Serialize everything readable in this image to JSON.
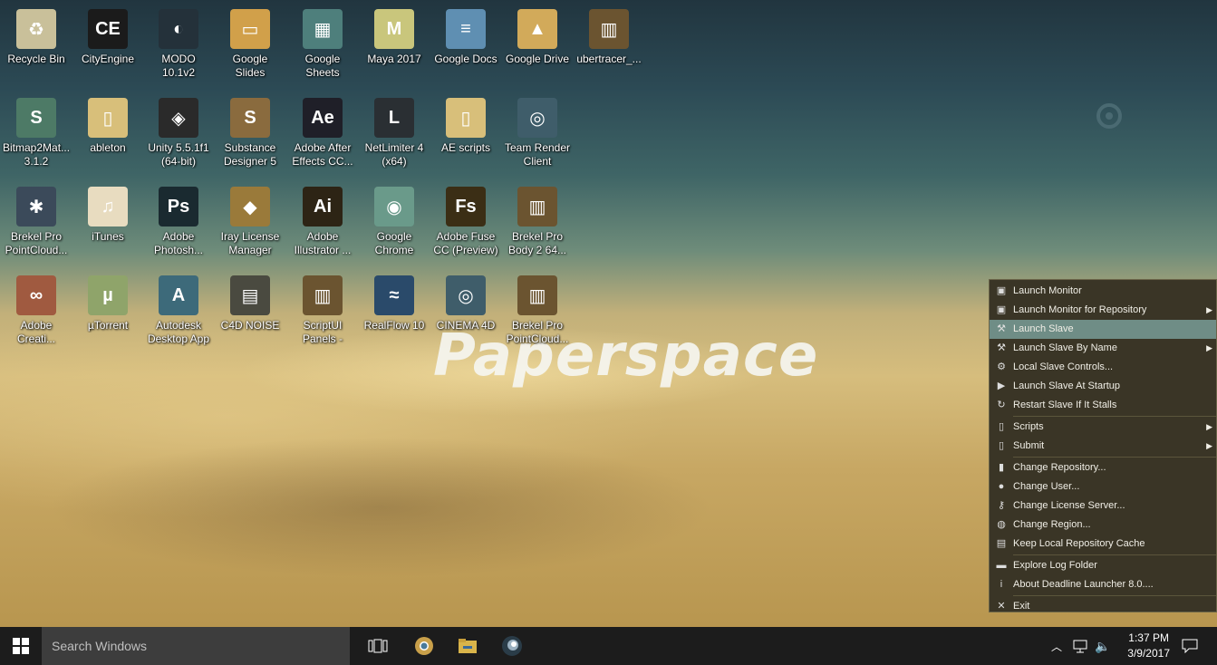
{
  "desktop": {
    "watermark": "Paperspace",
    "icons": [
      {
        "label": "Recycle Bin",
        "glyph": "♻",
        "color": "#c9c09a"
      },
      {
        "label": "CityEngine",
        "glyph": "CE",
        "color": "#1b1b1b"
      },
      {
        "label": "MODO 10.1v2",
        "glyph": "◐",
        "color": "#24313a"
      },
      {
        "label": "Google Slides",
        "glyph": "▭",
        "color": "#d1a04a"
      },
      {
        "label": "Google Sheets",
        "glyph": "▦",
        "color": "#4e7f7c"
      },
      {
        "label": "Maya 2017",
        "glyph": "M",
        "color": "#c9c67c"
      },
      {
        "label": "Google Docs",
        "glyph": "≡",
        "color": "#5f8fb2"
      },
      {
        "label": "Google Drive",
        "glyph": "▲",
        "color": "#d2aa5a"
      },
      {
        "label": "ubertracer_...",
        "glyph": "▥",
        "color": "#6b5430"
      },
      {
        "label": "Bitmap2Mat... 3.1.2",
        "glyph": "S",
        "color": "#4d7a66"
      },
      {
        "label": "ableton",
        "glyph": "▯",
        "color": "#d8bf7a"
      },
      {
        "label": "Unity 5.5.1f1 (64-bit)",
        "glyph": "◈",
        "color": "#2a2a2a"
      },
      {
        "label": "Substance Designer 5",
        "glyph": "S",
        "color": "#8a6b3e"
      },
      {
        "label": "Adobe After Effects CC...",
        "glyph": "Ae",
        "color": "#1f1f28"
      },
      {
        "label": "NetLimiter 4 (x64)",
        "glyph": "L",
        "color": "#2a2f33"
      },
      {
        "label": "AE scripts",
        "glyph": "▯",
        "color": "#d8bf7a"
      },
      {
        "label": "Team Render Client",
        "glyph": "◎",
        "color": "#3f5d6a"
      },
      {
        "label": "Brekel Pro PointCloud...",
        "glyph": "✱",
        "color": "#3b4a5a"
      },
      {
        "label": "iTunes",
        "glyph": "♫",
        "color": "#e8dcc0"
      },
      {
        "label": "Adobe Photosh...",
        "glyph": "Ps",
        "color": "#1a2a30"
      },
      {
        "label": "Iray License Manager",
        "glyph": "◆",
        "color": "#9a7a3a"
      },
      {
        "label": "Adobe Illustrator ...",
        "glyph": "Ai",
        "color": "#2d2415"
      },
      {
        "label": "Google Chrome",
        "glyph": "◉",
        "color": "#6a9a8a"
      },
      {
        "label": "Adobe Fuse CC (Preview)",
        "glyph": "Fs",
        "color": "#3b2e15"
      },
      {
        "label": "Brekel Pro Body 2 64...",
        "glyph": "▥",
        "color": "#6b5430"
      },
      {
        "label": "Adobe Creati...",
        "glyph": "∞",
        "color": "#a05a40"
      },
      {
        "label": "µTorrent",
        "glyph": "µ",
        "color": "#8fa46a"
      },
      {
        "label": "Autodesk Desktop App",
        "glyph": "A",
        "color": "#3d6a7a"
      },
      {
        "label": "C4D NOISE",
        "glyph": "▤",
        "color": "#4a4a40"
      },
      {
        "label": "ScriptUI Panels - MOE",
        "glyph": "▥",
        "color": "#6b5430"
      },
      {
        "label": "RealFlow 10",
        "glyph": "≈",
        "color": "#2a4a6a"
      },
      {
        "label": "CINEMA 4D",
        "glyph": "◎",
        "color": "#3f5d6a"
      },
      {
        "label": "Brekel Pro PointCloud...",
        "glyph": "▥",
        "color": "#6b5430"
      }
    ]
  },
  "context_menu": {
    "items": [
      {
        "label": "Launch Monitor",
        "icon": "monitor-icon",
        "glyph": "▣",
        "submenu": false,
        "highlighted": false
      },
      {
        "label": "Launch Monitor for Repository",
        "icon": "monitor-icon",
        "glyph": "▣",
        "submenu": true,
        "highlighted": false
      },
      {
        "label": "Launch Slave",
        "icon": "hammer-icon",
        "glyph": "⚒",
        "submenu": false,
        "highlighted": true
      },
      {
        "label": "Launch Slave By Name",
        "icon": "hammer-icon",
        "glyph": "⚒",
        "submenu": true,
        "highlighted": false
      },
      {
        "label": "Local Slave Controls...",
        "icon": "controls-icon",
        "glyph": "⚙",
        "submenu": false,
        "highlighted": false
      },
      {
        "label": "Launch Slave At Startup",
        "icon": "play-icon",
        "glyph": "▶",
        "submenu": false,
        "highlighted": false
      },
      {
        "label": "Restart Slave If It Stalls",
        "icon": "refresh-icon",
        "glyph": "↻",
        "submenu": false,
        "highlighted": false
      },
      {
        "sep": true
      },
      {
        "label": "Scripts",
        "icon": "document-icon",
        "glyph": "▯",
        "submenu": true,
        "highlighted": false
      },
      {
        "label": "Submit",
        "icon": "document-icon",
        "glyph": "▯",
        "submenu": true,
        "highlighted": false
      },
      {
        "sep": true
      },
      {
        "label": "Change Repository...",
        "icon": "server-icon",
        "glyph": "▮",
        "submenu": false,
        "highlighted": false
      },
      {
        "label": "Change User...",
        "icon": "user-icon",
        "glyph": "●",
        "submenu": false,
        "highlighted": false
      },
      {
        "label": "Change License Server...",
        "icon": "key-icon",
        "glyph": "⚷",
        "submenu": false,
        "highlighted": false
      },
      {
        "label": "Change Region...",
        "icon": "globe-icon",
        "glyph": "◍",
        "submenu": false,
        "highlighted": false
      },
      {
        "label": "Keep Local Repository Cache",
        "icon": "cache-icon",
        "glyph": "▤",
        "submenu": false,
        "highlighted": false
      },
      {
        "sep": true
      },
      {
        "label": "Explore Log Folder",
        "icon": "folder-icon",
        "glyph": "▬",
        "submenu": false,
        "highlighted": false
      },
      {
        "label": "About Deadline Launcher 8.0....",
        "icon": "info-icon",
        "glyph": "i",
        "submenu": false,
        "highlighted": false
      },
      {
        "sep": true
      },
      {
        "label": "Exit",
        "icon": "close-icon",
        "glyph": "✕",
        "submenu": false,
        "highlighted": false
      }
    ]
  },
  "taskbar": {
    "search_placeholder": "Search Windows",
    "time": "1:37 PM",
    "date": "3/9/2017"
  }
}
